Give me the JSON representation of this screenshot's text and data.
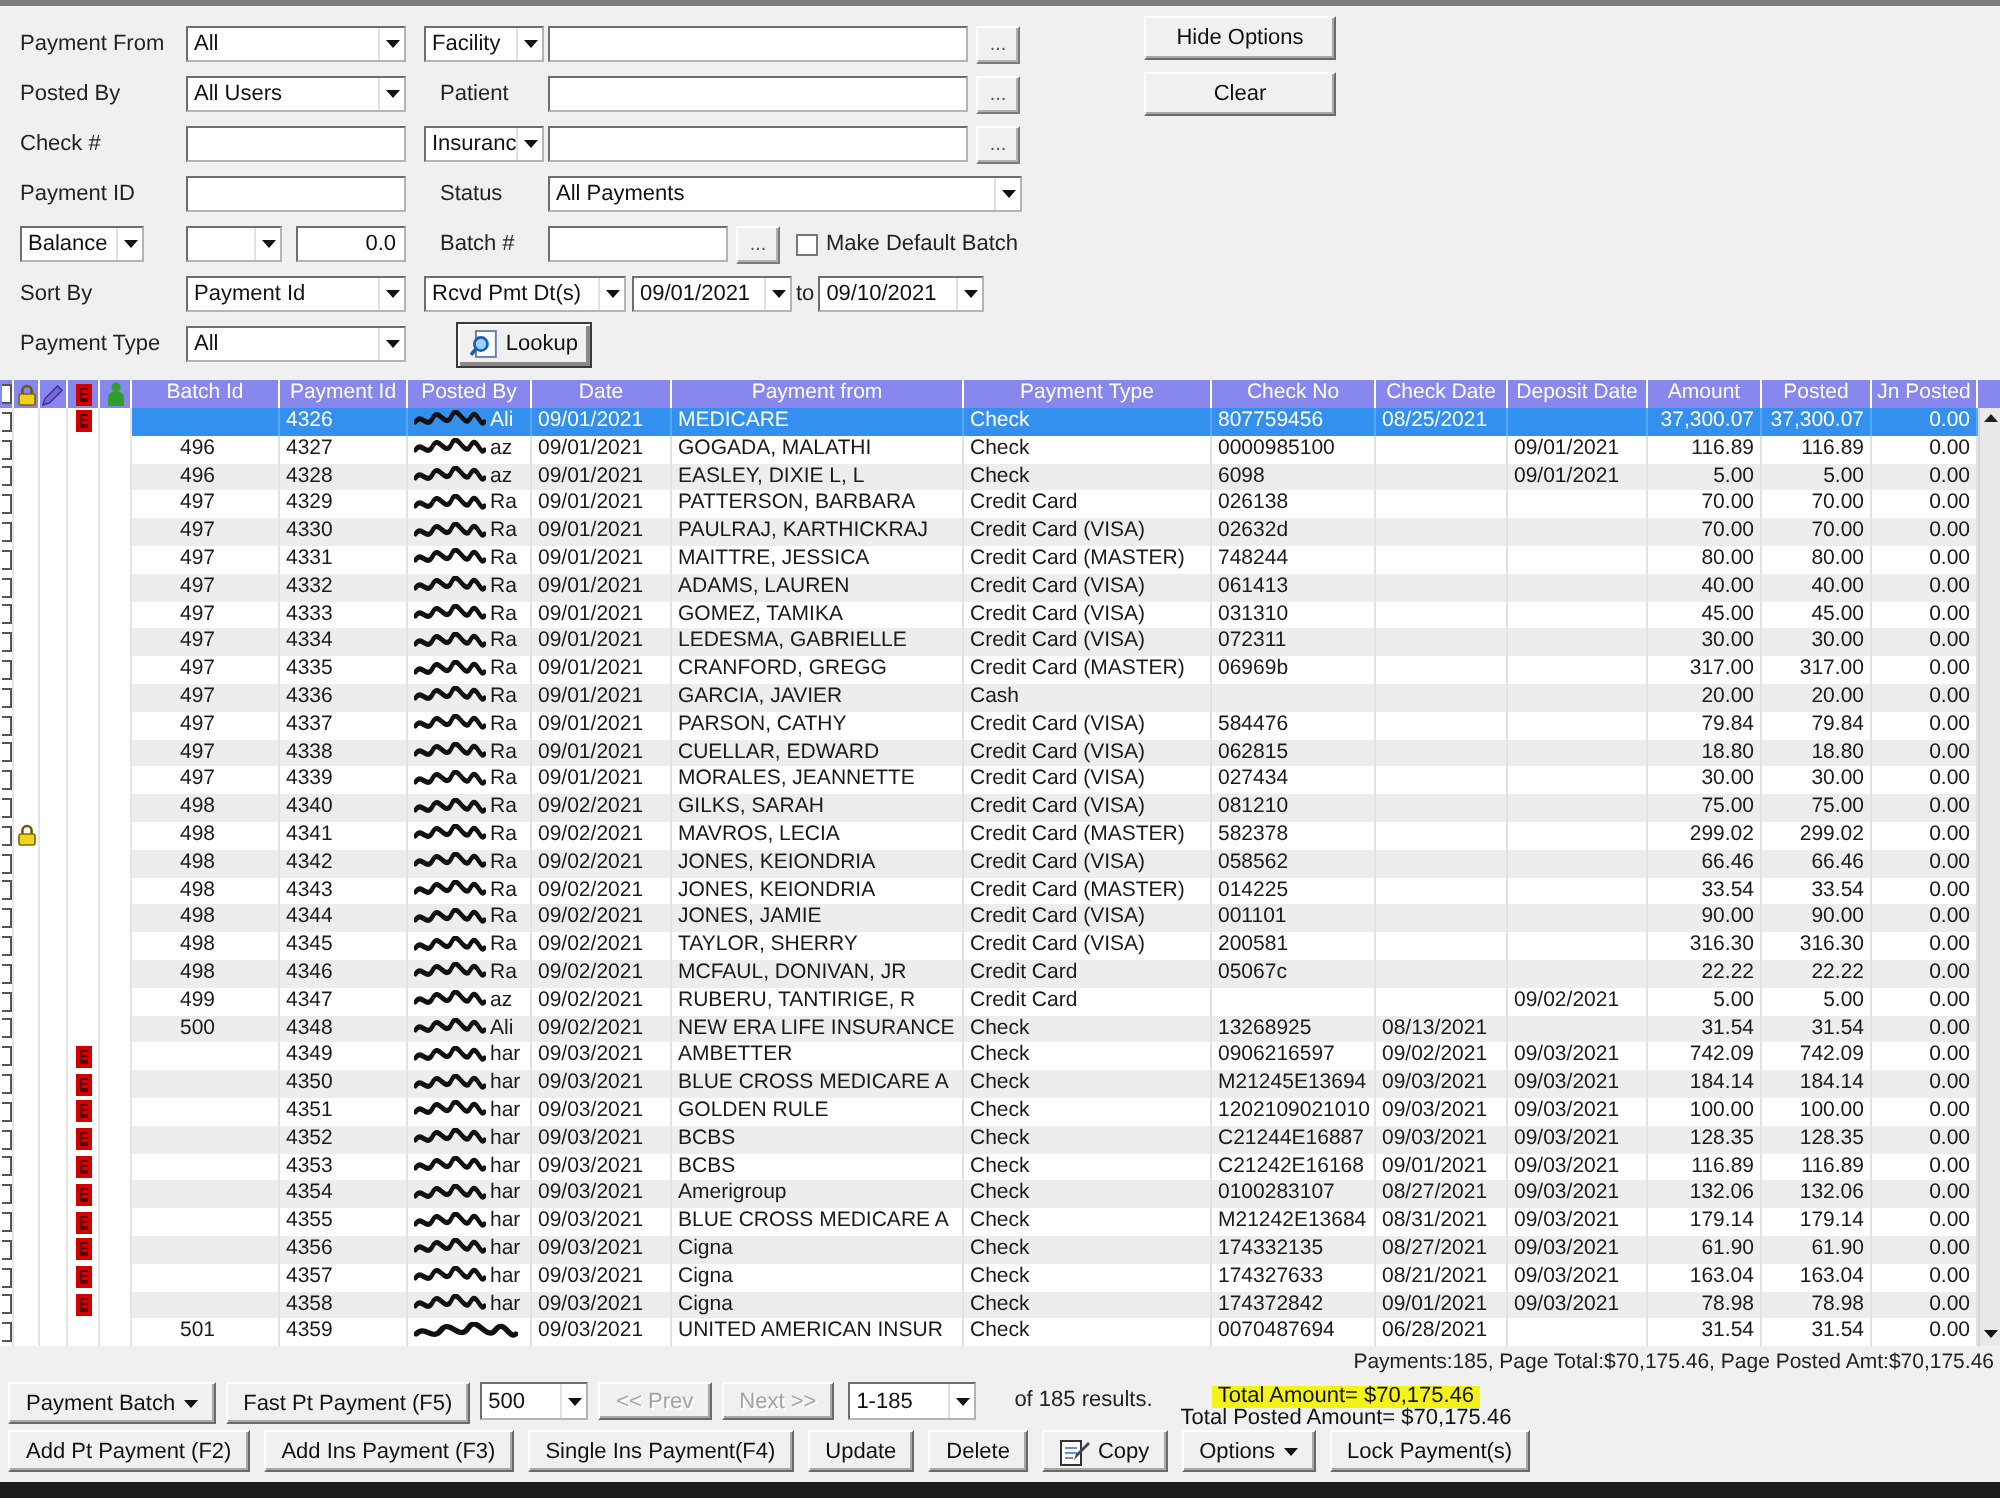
{
  "filters": {
    "payment_from": {
      "label": "Payment From",
      "value": "All"
    },
    "facility": {
      "type_value": "Facility",
      "browse": "..."
    },
    "posted_by": {
      "label": "Posted By",
      "value": "All Users"
    },
    "patient": {
      "label": "Patient",
      "browse": "..."
    },
    "check_no": {
      "label": "Check #"
    },
    "insurance": {
      "type_value": "Insuranc",
      "browse": "..."
    },
    "payment_id": {
      "label": "Payment ID"
    },
    "status": {
      "label": "Status",
      "value": "All Payments"
    },
    "balance": {
      "type_value": "Balance",
      "amount": "0.0"
    },
    "batch": {
      "label": "Batch #",
      "browse": "..."
    },
    "make_default_batch": {
      "label": "Make Default Batch",
      "checked": false
    },
    "sort_by": {
      "label": "Sort By",
      "value": "Payment Id"
    },
    "date_range": {
      "type_value": "Rcvd Pmt Dt(s)",
      "from": "09/01/2021",
      "separator": "to",
      "to": "09/10/2021"
    },
    "payment_type": {
      "label": "Payment Type",
      "value": "All"
    },
    "lookup_button": "Lookup"
  },
  "side_buttons": [
    {
      "label": "Hide Options"
    },
    {
      "label": "Clear"
    }
  ],
  "table": {
    "select_all_checked": false,
    "columns": [
      "Batch Id",
      "Payment Id",
      "Posted By",
      "Date",
      "Payment from",
      "Payment Type",
      "Check No",
      "Check Date",
      "Deposit Date",
      "Amount",
      "Posted",
      "Jn Posted"
    ],
    "rows": [
      {
        "checked": false,
        "locked": false,
        "flagged": true,
        "selected": true,
        "payment_id": "4326",
        "posted_by": "Ali",
        "date": "09/01/2021",
        "payment_from": "MEDICARE",
        "payment_type": "Check",
        "check_no": "807759456",
        "check_date": "08/25/2021",
        "amount": "37,300.07",
        "posted": "37,300.07",
        "jn_posted": "0.00"
      },
      {
        "checked": false,
        "locked": false,
        "flagged": false,
        "selected": false,
        "batch_id": "496",
        "payment_id": "4327",
        "posted_by": "az",
        "date": "09/01/2021",
        "payment_from": "GOGADA, MALATHI",
        "payment_type": "Check",
        "check_no": "0000985100",
        "deposit_date": "09/01/2021",
        "amount": "116.89",
        "posted": "116.89",
        "jn_posted": "0.00"
      },
      {
        "checked": false,
        "locked": false,
        "flagged": false,
        "selected": false,
        "batch_id": "496",
        "payment_id": "4328",
        "posted_by": "az",
        "date": "09/01/2021",
        "payment_from": "EASLEY, DIXIE L, L",
        "payment_type": "Check",
        "check_no": "6098",
        "deposit_date": "09/01/2021",
        "amount": "5.00",
        "posted": "5.00",
        "jn_posted": "0.00"
      },
      {
        "checked": false,
        "locked": false,
        "flagged": false,
        "selected": false,
        "batch_id": "497",
        "payment_id": "4329",
        "posted_by": "Ra",
        "date": "09/01/2021",
        "payment_from": "PATTERSON, BARBARA",
        "payment_type": "Credit Card",
        "check_no": "026138",
        "amount": "70.00",
        "posted": "70.00",
        "jn_posted": "0.00"
      },
      {
        "checked": false,
        "locked": false,
        "flagged": false,
        "selected": false,
        "batch_id": "497",
        "payment_id": "4330",
        "posted_by": "Ra",
        "date": "09/01/2021",
        "payment_from": "PAULRAJ, KARTHICKRAJ",
        "payment_type": "Credit Card (VISA)",
        "check_no": "02632d",
        "amount": "70.00",
        "posted": "70.00",
        "jn_posted": "0.00"
      },
      {
        "checked": false,
        "locked": false,
        "flagged": false,
        "selected": false,
        "batch_id": "497",
        "payment_id": "4331",
        "posted_by": "Ra",
        "date": "09/01/2021",
        "payment_from": "MAITTRE, JESSICA",
        "payment_type": "Credit Card (MASTER)",
        "check_no": "748244",
        "amount": "80.00",
        "posted": "80.00",
        "jn_posted": "0.00"
      },
      {
        "checked": false,
        "locked": false,
        "flagged": false,
        "selected": false,
        "batch_id": "497",
        "payment_id": "4332",
        "posted_by": "Ra",
        "date": "09/01/2021",
        "payment_from": "ADAMS, LAUREN",
        "payment_type": "Credit Card (VISA)",
        "check_no": "061413",
        "amount": "40.00",
        "posted": "40.00",
        "jn_posted": "0.00"
      },
      {
        "checked": false,
        "locked": false,
        "flagged": false,
        "selected": false,
        "batch_id": "497",
        "payment_id": "4333",
        "posted_by": "Ra",
        "date": "09/01/2021",
        "payment_from": "GOMEZ, TAMIKA",
        "payment_type": "Credit Card (VISA)",
        "check_no": "031310",
        "amount": "45.00",
        "posted": "45.00",
        "jn_posted": "0.00"
      },
      {
        "checked": false,
        "locked": false,
        "flagged": false,
        "selected": false,
        "batch_id": "497",
        "payment_id": "4334",
        "posted_by": "Ra",
        "date": "09/01/2021",
        "payment_from": "LEDESMA, GABRIELLE",
        "payment_type": "Credit Card (VISA)",
        "check_no": "072311",
        "amount": "30.00",
        "posted": "30.00",
        "jn_posted": "0.00"
      },
      {
        "checked": false,
        "locked": false,
        "flagged": false,
        "selected": false,
        "batch_id": "497",
        "payment_id": "4335",
        "posted_by": "Ra",
        "date": "09/01/2021",
        "payment_from": "CRANFORD, GREGG",
        "payment_type": "Credit Card (MASTER)",
        "check_no": "06969b",
        "amount": "317.00",
        "posted": "317.00",
        "jn_posted": "0.00"
      },
      {
        "checked": false,
        "locked": false,
        "flagged": false,
        "selected": false,
        "batch_id": "497",
        "payment_id": "4336",
        "posted_by": "Ra",
        "date": "09/01/2021",
        "payment_from": "GARCIA, JAVIER",
        "payment_type": "Cash",
        "amount": "20.00",
        "posted": "20.00",
        "jn_posted": "0.00"
      },
      {
        "checked": false,
        "locked": false,
        "flagged": false,
        "selected": false,
        "batch_id": "497",
        "payment_id": "4337",
        "posted_by": "Ra",
        "date": "09/01/2021",
        "payment_from": "PARSON, CATHY",
        "payment_type": "Credit Card (VISA)",
        "check_no": "584476",
        "amount": "79.84",
        "posted": "79.84",
        "jn_posted": "0.00"
      },
      {
        "checked": false,
        "locked": false,
        "flagged": false,
        "selected": false,
        "batch_id": "497",
        "payment_id": "4338",
        "posted_by": "Ra",
        "date": "09/01/2021",
        "payment_from": "CUELLAR, EDWARD",
        "payment_type": "Credit Card (VISA)",
        "check_no": "062815",
        "amount": "18.80",
        "posted": "18.80",
        "jn_posted": "0.00"
      },
      {
        "checked": false,
        "locked": false,
        "flagged": false,
        "selected": false,
        "batch_id": "497",
        "payment_id": "4339",
        "posted_by": "Ra",
        "date": "09/01/2021",
        "payment_from": "MORALES, JEANNETTE",
        "payment_type": "Credit Card (VISA)",
        "check_no": "027434",
        "amount": "30.00",
        "posted": "30.00",
        "jn_posted": "0.00"
      },
      {
        "checked": false,
        "locked": false,
        "flagged": false,
        "selected": false,
        "batch_id": "498",
        "payment_id": "4340",
        "posted_by": "Ra",
        "date": "09/02/2021",
        "payment_from": "GILKS, SARAH",
        "payment_type": "Credit Card (VISA)",
        "check_no": "081210",
        "amount": "75.00",
        "posted": "75.00",
        "jn_posted": "0.00"
      },
      {
        "checked": false,
        "locked": true,
        "flagged": false,
        "selected": false,
        "batch_id": "498",
        "payment_id": "4341",
        "posted_by": "Ra",
        "date": "09/02/2021",
        "payment_from": "MAVROS, LECIA",
        "payment_type": "Credit Card (MASTER)",
        "check_no": "582378",
        "amount": "299.02",
        "posted": "299.02",
        "jn_posted": "0.00"
      },
      {
        "checked": false,
        "locked": false,
        "flagged": false,
        "selected": false,
        "batch_id": "498",
        "payment_id": "4342",
        "posted_by": "Ra",
        "date": "09/02/2021",
        "payment_from": "JONES, KEIONDRIA",
        "payment_type": "Credit Card (VISA)",
        "check_no": "058562",
        "amount": "66.46",
        "posted": "66.46",
        "jn_posted": "0.00"
      },
      {
        "checked": false,
        "locked": false,
        "flagged": false,
        "selected": false,
        "batch_id": "498",
        "payment_id": "4343",
        "posted_by": "Ra",
        "date": "09/02/2021",
        "payment_from": "JONES, KEIONDRIA",
        "payment_type": "Credit Card (MASTER)",
        "check_no": "014225",
        "amount": "33.54",
        "posted": "33.54",
        "jn_posted": "0.00"
      },
      {
        "checked": false,
        "locked": false,
        "flagged": false,
        "selected": false,
        "batch_id": "498",
        "payment_id": "4344",
        "posted_by": "Ra",
        "date": "09/02/2021",
        "payment_from": "JONES, JAMIE",
        "payment_type": "Credit Card (VISA)",
        "check_no": "001101",
        "amount": "90.00",
        "posted": "90.00",
        "jn_posted": "0.00"
      },
      {
        "checked": false,
        "locked": false,
        "flagged": false,
        "selected": false,
        "batch_id": "498",
        "payment_id": "4345",
        "posted_by": "Ra",
        "date": "09/02/2021",
        "payment_from": "TAYLOR, SHERRY",
        "payment_type": "Credit Card (VISA)",
        "check_no": "200581",
        "amount": "316.30",
        "posted": "316.30",
        "jn_posted": "0.00"
      },
      {
        "checked": false,
        "locked": false,
        "flagged": false,
        "selected": false,
        "batch_id": "498",
        "payment_id": "4346",
        "posted_by": "Ra",
        "date": "09/02/2021",
        "payment_from": "MCFAUL, DONIVAN, JR",
        "payment_type": "Credit Card",
        "check_no": "05067c",
        "amount": "22.22",
        "posted": "22.22",
        "jn_posted": "0.00"
      },
      {
        "checked": false,
        "locked": false,
        "flagged": false,
        "selected": false,
        "batch_id": "499",
        "payment_id": "4347",
        "posted_by": "az",
        "date": "09/02/2021",
        "payment_from": "RUBERU, TANTIRIGE, R",
        "payment_type": "Credit Card",
        "deposit_date": "09/02/2021",
        "amount": "5.00",
        "posted": "5.00",
        "jn_posted": "0.00"
      },
      {
        "checked": false,
        "locked": false,
        "flagged": false,
        "selected": false,
        "batch_id": "500",
        "payment_id": "4348",
        "posted_by": "Ali",
        "date": "09/02/2021",
        "payment_from": "NEW ERA LIFE INSURANCE",
        "payment_type": "Check",
        "check_no": "13268925",
        "check_date": "08/13/2021",
        "amount": "31.54",
        "posted": "31.54",
        "jn_posted": "0.00"
      },
      {
        "checked": false,
        "locked": false,
        "flagged": true,
        "selected": false,
        "payment_id": "4349",
        "posted_by": "har",
        "date": "09/03/2021",
        "payment_from": "AMBETTER",
        "payment_type": "Check",
        "check_no": "0906216597",
        "check_date": "09/02/2021",
        "deposit_date": "09/03/2021",
        "amount": "742.09",
        "posted": "742.09",
        "jn_posted": "0.00"
      },
      {
        "checked": false,
        "locked": false,
        "flagged": true,
        "selected": false,
        "payment_id": "4350",
        "posted_by": "har",
        "date": "09/03/2021",
        "payment_from": "BLUE CROSS MEDICARE A",
        "payment_type": "Check",
        "check_no": "M21245E13694",
        "check_date": "09/03/2021",
        "deposit_date": "09/03/2021",
        "amount": "184.14",
        "posted": "184.14",
        "jn_posted": "0.00"
      },
      {
        "checked": false,
        "locked": false,
        "flagged": true,
        "selected": false,
        "payment_id": "4351",
        "posted_by": "har",
        "date": "09/03/2021",
        "payment_from": "GOLDEN RULE",
        "payment_type": "Check",
        "check_no": "1202109021010",
        "check_date": "09/03/2021",
        "deposit_date": "09/03/2021",
        "amount": "100.00",
        "posted": "100.00",
        "jn_posted": "0.00"
      },
      {
        "checked": false,
        "locked": false,
        "flagged": true,
        "selected": false,
        "payment_id": "4352",
        "posted_by": "har",
        "date": "09/03/2021",
        "payment_from": "BCBS",
        "payment_type": "Check",
        "check_no": "C21244E16887",
        "check_date": "09/03/2021",
        "deposit_date": "09/03/2021",
        "amount": "128.35",
        "posted": "128.35",
        "jn_posted": "0.00"
      },
      {
        "checked": false,
        "locked": false,
        "flagged": true,
        "selected": false,
        "payment_id": "4353",
        "posted_by": "har",
        "date": "09/03/2021",
        "payment_from": "BCBS",
        "payment_type": "Check",
        "check_no": "C21242E16168",
        "check_date": "09/01/2021",
        "deposit_date": "09/03/2021",
        "amount": "116.89",
        "posted": "116.89",
        "jn_posted": "0.00"
      },
      {
        "checked": false,
        "locked": false,
        "flagged": true,
        "selected": false,
        "payment_id": "4354",
        "posted_by": "har",
        "date": "09/03/2021",
        "payment_from": "Amerigroup",
        "payment_type": "Check",
        "check_no": "0100283107",
        "check_date": "08/27/2021",
        "deposit_date": "09/03/2021",
        "amount": "132.06",
        "posted": "132.06",
        "jn_posted": "0.00"
      },
      {
        "checked": false,
        "locked": false,
        "flagged": true,
        "selected": false,
        "payment_id": "4355",
        "posted_by": "har",
        "date": "09/03/2021",
        "payment_from": "BLUE CROSS MEDICARE A",
        "payment_type": "Check",
        "check_no": "M21242E13684",
        "check_date": "08/31/2021",
        "deposit_date": "09/03/2021",
        "amount": "179.14",
        "posted": "179.14",
        "jn_posted": "0.00"
      },
      {
        "checked": false,
        "locked": false,
        "flagged": true,
        "selected": false,
        "payment_id": "4356",
        "posted_by": "har",
        "date": "09/03/2021",
        "payment_from": "Cigna",
        "payment_type": "Check",
        "check_no": "174332135",
        "check_date": "08/27/2021",
        "deposit_date": "09/03/2021",
        "amount": "61.90",
        "posted": "61.90",
        "jn_posted": "0.00"
      },
      {
        "checked": false,
        "locked": false,
        "flagged": true,
        "selected": false,
        "payment_id": "4357",
        "posted_by": "har",
        "date": "09/03/2021",
        "payment_from": "Cigna",
        "payment_type": "Check",
        "check_no": "174327633",
        "check_date": "08/21/2021",
        "deposit_date": "09/03/2021",
        "amount": "163.04",
        "posted": "163.04",
        "jn_posted": "0.00"
      },
      {
        "checked": false,
        "locked": false,
        "flagged": true,
        "selected": false,
        "payment_id": "4358",
        "posted_by": "har",
        "date": "09/03/2021",
        "payment_from": "Cigna",
        "payment_type": "Check",
        "check_no": "174372842",
        "check_date": "09/01/2021",
        "deposit_date": "09/03/2021",
        "amount": "78.98",
        "posted": "78.98",
        "jn_posted": "0.00"
      },
      {
        "checked": false,
        "locked": false,
        "flagged": false,
        "selected": false,
        "batch_id": "501",
        "payment_id": "4359",
        "date": "09/03/2021",
        "payment_from": "UNITED AMERICAN INSUR",
        "payment_type": "Check",
        "check_no": "0070487694",
        "check_date": "06/28/2021",
        "amount": "31.54",
        "posted": "31.54",
        "jn_posted": "0.00"
      }
    ]
  },
  "summary": "Payments:185, Page Total:$70,175.46, Page Posted Amt:$70,175.46",
  "batch_actions": [
    {
      "kind": "menu",
      "label": "Payment Batch"
    },
    {
      "kind": "button",
      "label": "Fast Pt Payment (F5)"
    }
  ],
  "pager": {
    "page_size": "500",
    "prev": {
      "label": "<< Prev",
      "disabled": true
    },
    "next": {
      "label": "Next >>",
      "disabled": true
    },
    "range": "1-185",
    "results": "of 185 results."
  },
  "totals": {
    "total_amount": {
      "text": "Total Amount= $70,175.46",
      "highlighted": true
    },
    "total_posted": "Total Posted Amount= $70,175.46"
  },
  "actions": [
    {
      "kind": "button",
      "label": "Add Pt Payment (F2)"
    },
    {
      "kind": "button",
      "label": "Add Ins Payment (F3)"
    },
    {
      "kind": "button",
      "label": "Single Ins Payment(F4)"
    },
    {
      "kind": "button",
      "label": "Update"
    },
    {
      "kind": "button",
      "label": "Delete"
    },
    {
      "kind": "copy",
      "label": "Copy"
    },
    {
      "kind": "menu",
      "label": "Options"
    },
    {
      "kind": "button",
      "label": "Lock Payment(s)"
    }
  ]
}
